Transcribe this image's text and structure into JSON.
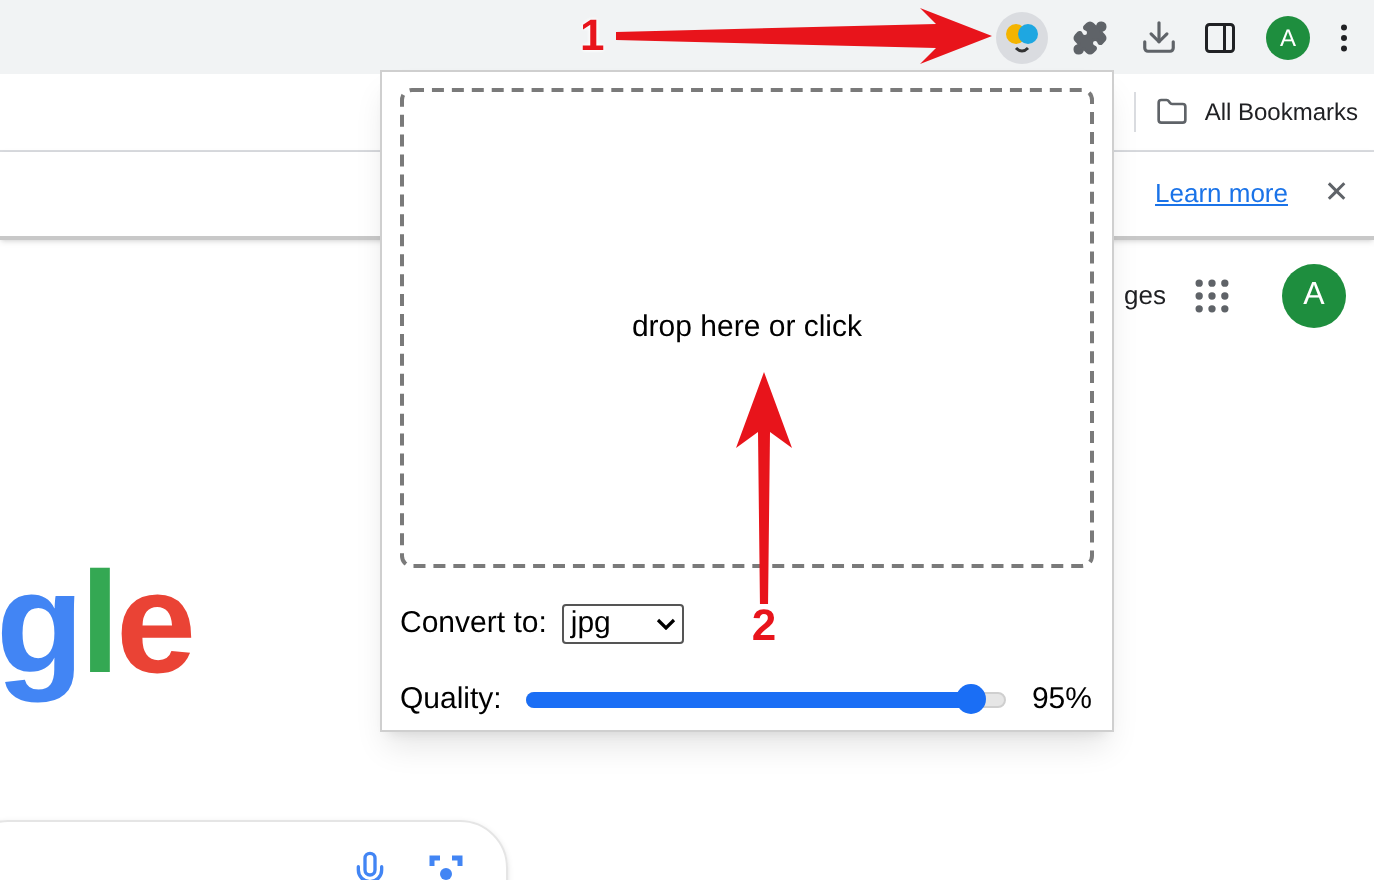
{
  "toolbar": {
    "profile_initial": "A",
    "extension_active": true
  },
  "bookmarks_bar": {
    "folder": "All Bookmarks"
  },
  "info_bar": {
    "link": "Learn more",
    "close": "✕"
  },
  "page": {
    "header_link": "ges",
    "avatar_initial": "A",
    "logo_letters": [
      {
        "text": "g",
        "color": "#4285f4"
      },
      {
        "text": "l",
        "color": "#34a853"
      },
      {
        "text": "e",
        "color": "#ea4335"
      }
    ]
  },
  "popup": {
    "drop_zone": "drop here or click",
    "convert_label": "Convert to:",
    "format": "jpg",
    "quality_label": "Quality:",
    "quality": {
      "level": 0.93,
      "reading": "95%"
    }
  },
  "annotations": [
    {
      "label": "1",
      "kind": "right"
    },
    {
      "label": "2",
      "kind": "up"
    }
  ]
}
